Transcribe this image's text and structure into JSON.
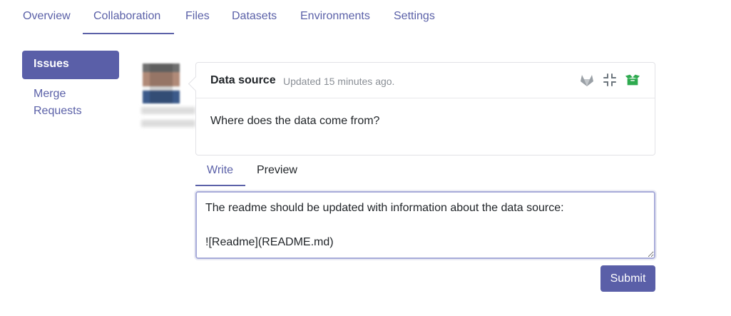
{
  "top_tabs": [
    {
      "label": "Overview"
    },
    {
      "label": "Collaboration",
      "active": true
    },
    {
      "label": "Files"
    },
    {
      "label": "Datasets"
    },
    {
      "label": "Environments"
    },
    {
      "label": "Settings"
    }
  ],
  "sidebar": {
    "items": [
      {
        "label": "Issues",
        "active": true
      },
      {
        "label": "Merge Requests"
      }
    ]
  },
  "issue": {
    "title": "Data source",
    "updated": "Updated 15 minutes ago.",
    "body": "Where does the data come from?",
    "icons": [
      "gitlab-icon",
      "collapse-icon",
      "open-box-icon"
    ],
    "icon_colors": {
      "gitlab": "#9aa0a6",
      "collapse": "#6c757d",
      "box": "#2eaa4f"
    }
  },
  "editor": {
    "tabs": [
      {
        "label": "Write",
        "active": true
      },
      {
        "label": "Preview"
      }
    ],
    "value": "The readme should be updated with information about the data source:\n\n![Readme](README.md)"
  },
  "submit_label": "Submit",
  "colors": {
    "accent": "#5a5fa8"
  }
}
